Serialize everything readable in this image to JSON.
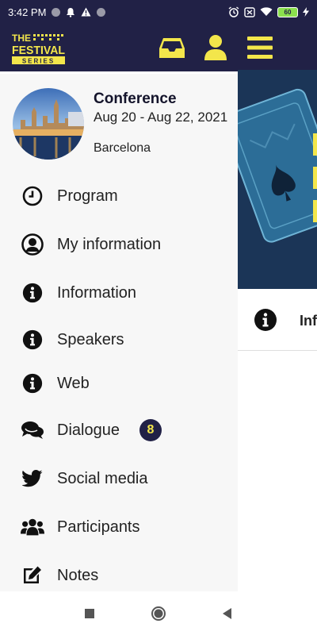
{
  "status_bar": {
    "time": "3:42 PM",
    "battery": "60"
  },
  "header": {
    "logo_line1": "THE",
    "logo_line2": "FESTIVAL",
    "logo_line3": "SERIES",
    "icons": [
      "inbox-icon",
      "user-icon",
      "menu-icon"
    ]
  },
  "drawer": {
    "event_name": "Conference",
    "event_dates": "Aug 20 - Aug 22, 2021",
    "event_city": "Barcelona",
    "items": [
      {
        "label": "Program",
        "icon": "clock-icon"
      },
      {
        "label": "My information",
        "icon": "user-circle-icon"
      },
      {
        "label": "Information",
        "icon": "info-icon"
      },
      {
        "label": "Speakers",
        "icon": "info-icon"
      },
      {
        "label": "Web",
        "icon": "info-icon"
      },
      {
        "label": "Dialogue",
        "icon": "chat-icon",
        "badge": "8"
      },
      {
        "label": "Social media",
        "icon": "twitter-icon"
      },
      {
        "label": "Participants",
        "icon": "users-icon"
      },
      {
        "label": "Notes",
        "icon": "edit-icon"
      }
    ]
  },
  "background_page": {
    "row_text": "Inf"
  },
  "colors": {
    "header": "#212146",
    "accent": "#f3e64b",
    "drawer_bg": "#f7f7f7"
  }
}
